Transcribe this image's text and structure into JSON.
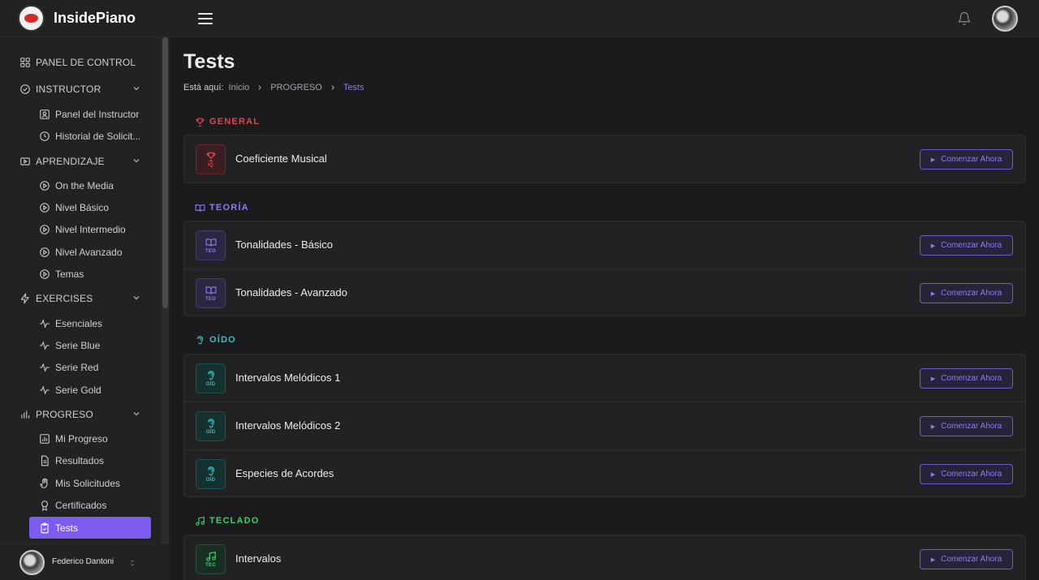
{
  "app": {
    "name": "InsidePiano"
  },
  "header": {
    "notifications_icon": "bell-icon",
    "avatar": "user-avatar"
  },
  "sidebar": {
    "sections": [
      {
        "label": "PANEL DE CONTROL",
        "icon": "grid-icon"
      },
      {
        "label": "INSTRUCTOR",
        "icon": "check-circle-icon",
        "items": [
          {
            "label": "Panel del Instructor",
            "icon": "user-square-icon"
          },
          {
            "label": "Historial de Solicit...",
            "icon": "clock-icon"
          }
        ]
      },
      {
        "label": "APRENDIZAJE",
        "icon": "video-icon",
        "items": [
          {
            "label": "On the Media",
            "icon": "play-circle-icon"
          },
          {
            "label": "Nivel Básico",
            "icon": "play-circle-icon"
          },
          {
            "label": "Nivel Intermedio",
            "icon": "play-circle-icon"
          },
          {
            "label": "Nivel Avanzado",
            "icon": "play-circle-icon"
          },
          {
            "label": "Temas",
            "icon": "play-circle-icon"
          }
        ]
      },
      {
        "label": "EXERCISES",
        "icon": "bolt-icon",
        "items": [
          {
            "label": "Esenciales",
            "icon": "pulse-icon"
          },
          {
            "label": "Serie Blue",
            "icon": "pulse-icon"
          },
          {
            "label": "Serie Red",
            "icon": "pulse-icon"
          },
          {
            "label": "Serie Gold",
            "icon": "pulse-icon"
          }
        ]
      },
      {
        "label": "PROGRESO",
        "icon": "bar-chart-icon",
        "items": [
          {
            "label": "Mi Progreso",
            "icon": "chart-box-icon"
          },
          {
            "label": "Resultados",
            "icon": "document-icon"
          },
          {
            "label": "Mis Solicitudes",
            "icon": "hand-icon"
          },
          {
            "label": "Certificados",
            "icon": "award-icon"
          },
          {
            "label": "Tests",
            "icon": "clipboard-check-icon",
            "active": true
          }
        ]
      }
    ],
    "user": {
      "name": "Federico Dantoni"
    }
  },
  "main": {
    "title": "Tests",
    "breadcrumb": {
      "label": "Está aquí:",
      "items": [
        "Inicio",
        "PROGRESO",
        "Tests"
      ]
    },
    "action_label": "Comenzar Ahora",
    "groups": [
      {
        "title": "GENERAL",
        "icon": "trophy-icon",
        "color": "#e0484d",
        "tests": [
          {
            "name": "Coeficiente Musical",
            "code": "IQ",
            "icon": "trophy-icon"
          }
        ]
      },
      {
        "title": "TEORÍA",
        "icon": "book-icon",
        "color": "#8b7cf6",
        "tests": [
          {
            "name": "Tonalidades - Básico",
            "code": "TEO",
            "icon": "book-icon"
          },
          {
            "name": "Tonalidades - Avanzado",
            "code": "TEO",
            "icon": "book-icon"
          }
        ]
      },
      {
        "title": "OÍDO",
        "icon": "ear-icon",
        "color": "#2bc3c0",
        "tests": [
          {
            "name": "Intervalos Melódicos 1",
            "code": "OÍD",
            "icon": "ear-icon"
          },
          {
            "name": "Intervalos Melódicos 2",
            "code": "OÍD",
            "icon": "ear-icon"
          },
          {
            "name": "Especies de Acordes",
            "code": "OÍD",
            "icon": "ear-icon"
          }
        ]
      },
      {
        "title": "TECLADO",
        "icon": "music-note-icon",
        "color": "#3ccf6b",
        "tests": [
          {
            "name": "Intervalos",
            "code": "TEC",
            "icon": "music-note-icon"
          }
        ]
      }
    ]
  }
}
